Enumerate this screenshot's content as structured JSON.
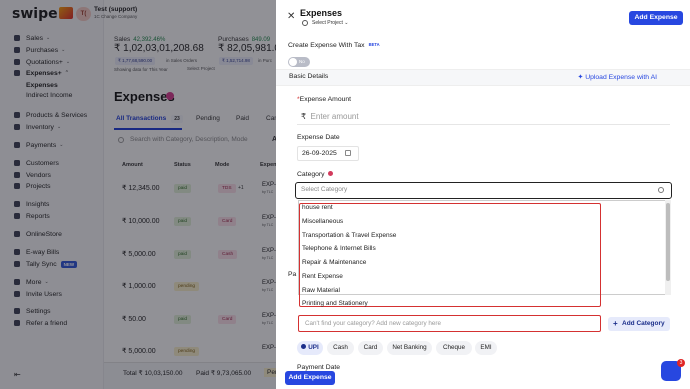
{
  "app": {
    "logo": "swipe"
  },
  "business": {
    "avatar": "T(",
    "name": "Test (support)",
    "sub": "1C Change Company"
  },
  "sidebar": {
    "items": [
      {
        "label": "Sales",
        "chev": "⌄"
      },
      {
        "label": "Purchases",
        "chev": "⌄"
      },
      {
        "label": "Quotations+",
        "chev": "⌄"
      },
      {
        "label": "Expenses+",
        "chev": "⌃"
      },
      {
        "label": "Expenses"
      },
      {
        "label": "Indirect Income"
      },
      {
        "label": "Products & Services"
      },
      {
        "label": "Inventory",
        "chev": "⌄"
      },
      {
        "label": "Payments",
        "chev": "⌄"
      },
      {
        "label": "Customers"
      },
      {
        "label": "Vendors"
      },
      {
        "label": "Projects"
      },
      {
        "label": "Insights"
      },
      {
        "label": "Reports"
      },
      {
        "label": "OnlineStore"
      },
      {
        "label": "E-way Bills"
      },
      {
        "label": "Tally Sync",
        "badge": "NEW"
      },
      {
        "label": "More",
        "chev": "⌄"
      },
      {
        "label": "Invite Users"
      },
      {
        "label": "Settings"
      },
      {
        "label": "Refer a friend"
      }
    ],
    "collapse_icon": "⇤"
  },
  "stats": {
    "sales_label": "Sales",
    "sales_change": "42,392.46%",
    "sales_value": "₹ 1,02,03,01,208.68",
    "sales_chip": "₹ 1,77,68,590.00",
    "sales_note": "in Sales Orders",
    "purchases_label": "Purchases",
    "purchases_change": "849.09",
    "purchases_value": "₹ 82,05,981.00",
    "purchases_chip": "₹ 1,52,714.98",
    "purchases_note": "in Purc",
    "showing": "Showing data for This Year",
    "select_project": "Select Project"
  },
  "page": {
    "title": "Expenses",
    "tabs": [
      {
        "label": "All Transactions",
        "count": "23"
      },
      {
        "label": "Pending"
      },
      {
        "label": "Paid"
      },
      {
        "label": "Can"
      }
    ],
    "search_placeholder": "Search with Category, Description, Mode",
    "search_btn": "A",
    "columns": [
      "Amount",
      "Status",
      "Mode",
      "Expen"
    ],
    "rows": [
      {
        "amount": "₹ 12,345.00",
        "status": "paid",
        "mode": "TDS",
        "extra": "+1",
        "ref": "EXP-"
      },
      {
        "amount": "₹ 10,000.00",
        "status": "paid",
        "mode": "Card",
        "ref": "EXP-"
      },
      {
        "amount": "₹ 5,000.00",
        "status": "paid",
        "mode": "Cash",
        "ref": "EXP-"
      },
      {
        "amount": "₹ 1,000.00",
        "status": "pending",
        "mode": "",
        "ref": "EXP-"
      },
      {
        "amount": "₹ 50.00",
        "status": "paid",
        "mode": "Card",
        "ref": "EXP-"
      },
      {
        "amount": "₹ 5,000.00",
        "status": "pending",
        "mode": "",
        "ref": "EXP-"
      }
    ],
    "ref_by": "by TLC",
    "footer_total": "Total ₹ 10,03,150.00",
    "footer_paid": "Paid ₹ 9,73,065.00",
    "footer_pending": "Pen"
  },
  "drawer": {
    "title": "Expenses",
    "select_project": "Select Project",
    "add_btn": "Add Expense",
    "create_with_tax": "Create Expense With Tax",
    "beta": "BETA",
    "toggle": "No",
    "basic_details": "Basic Details",
    "upload_ai": "Upload Expense with AI",
    "amount_label": "Expense Amount",
    "amount_placeholder": "Enter amount",
    "date_label": "Expense Date",
    "date_value": "26-09-2025",
    "category_label": "Category",
    "category_placeholder": "Select Category",
    "categories": [
      "house rent",
      "Miscellaneous",
      "Transportation & Travel Expense",
      "Telephone & Internet Bills",
      "Repair & Maintenance",
      "Rent Expense",
      "Raw Material",
      "Printing and Stationery"
    ],
    "new_cat_placeholder": "Can't find your category? Add new category here",
    "add_category": "Add Category",
    "payment_modes": [
      "UPI",
      "Cash",
      "Card",
      "Net Banking",
      "Cheque",
      "EMI"
    ],
    "payment_date_label": "Payment Date",
    "pa_fragment": "Pa",
    "bottom_btn": "Add Expense"
  },
  "chat": {
    "badge": "3"
  }
}
